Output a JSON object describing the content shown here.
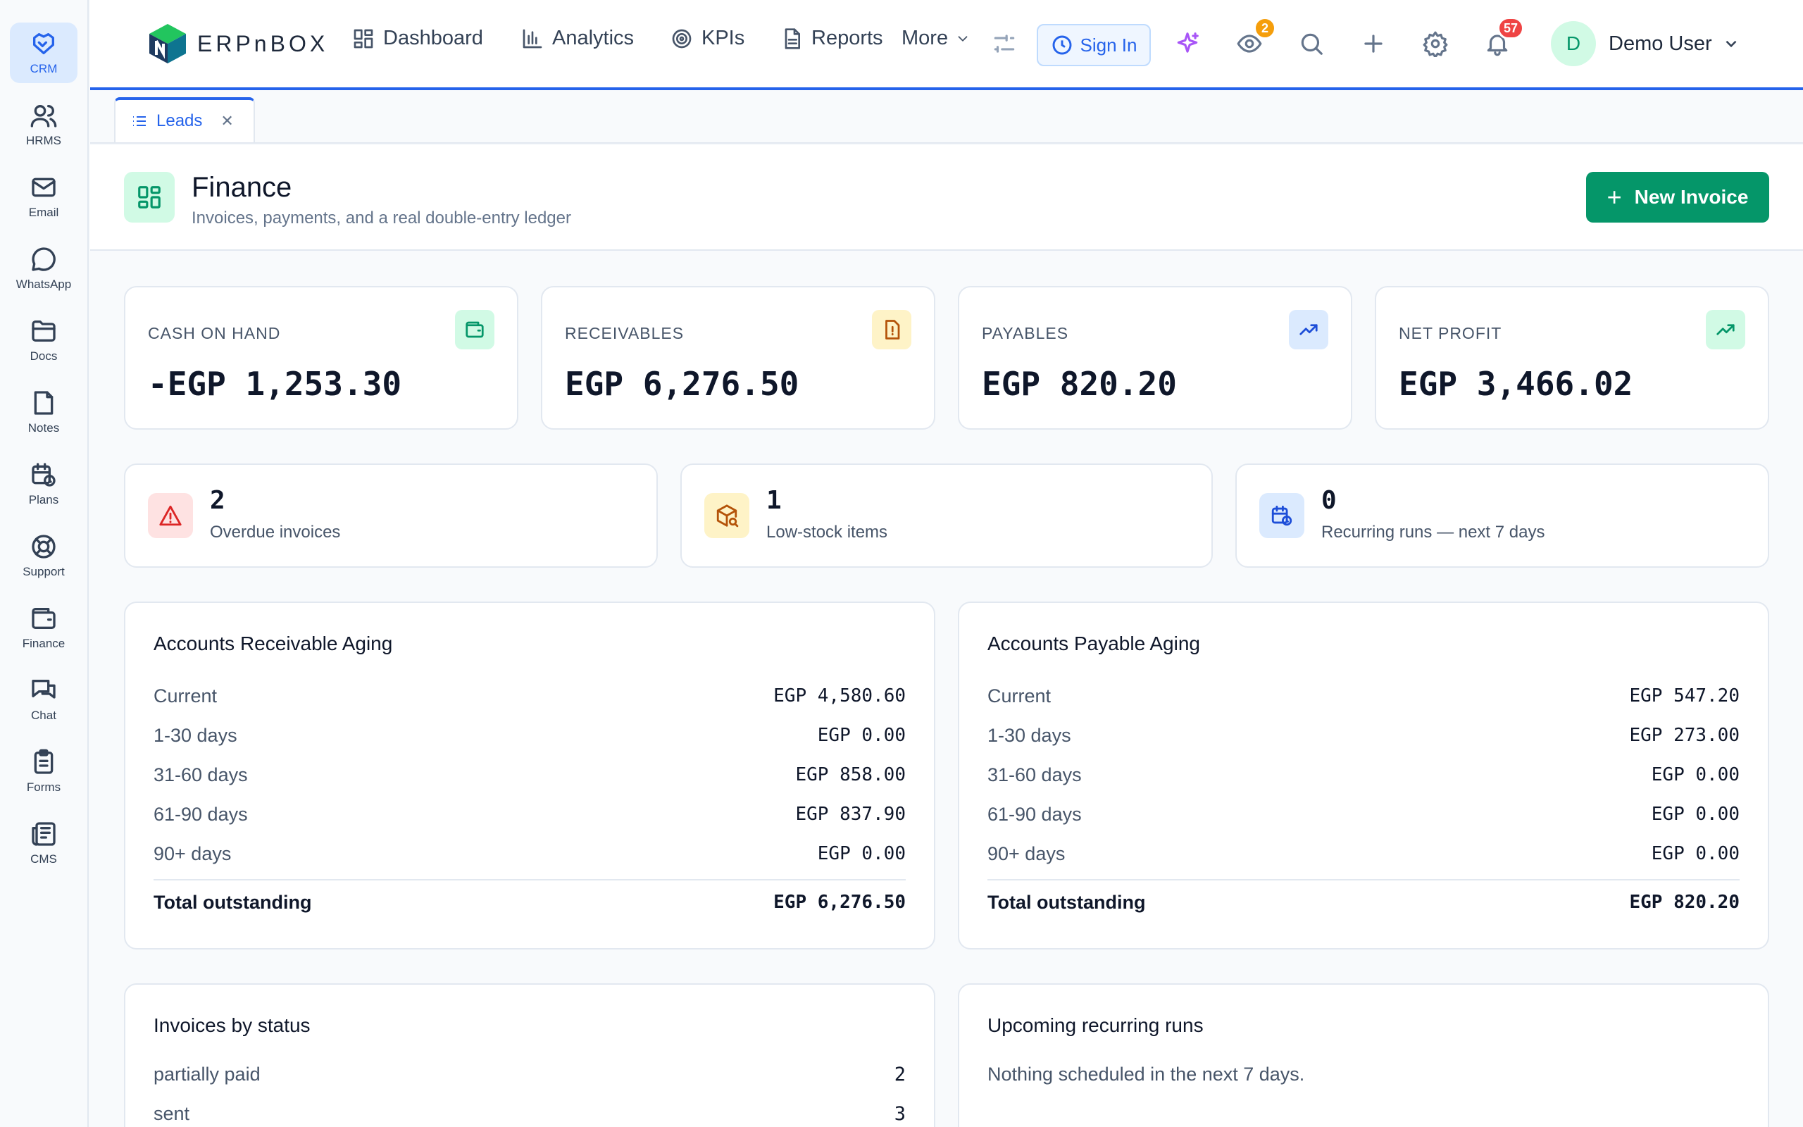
{
  "sidebar": {
    "items": [
      {
        "label": "CRM",
        "icon": "handshake-icon"
      },
      {
        "label": "HRMS",
        "icon": "users-icon"
      },
      {
        "label": "Email",
        "icon": "mail-icon"
      },
      {
        "label": "WhatsApp",
        "icon": "chat-bubble-icon"
      },
      {
        "label": "Docs",
        "icon": "folder-icon"
      },
      {
        "label": "Notes",
        "icon": "note-icon"
      },
      {
        "label": "Plans",
        "icon": "calendar-clock-icon"
      },
      {
        "label": "Support",
        "icon": "lifebuoy-icon"
      },
      {
        "label": "Finance",
        "icon": "wallet-icon"
      },
      {
        "label": "Chat",
        "icon": "messages-icon"
      },
      {
        "label": "Forms",
        "icon": "clipboard-icon"
      },
      {
        "label": "CMS",
        "icon": "newspaper-icon"
      }
    ]
  },
  "header": {
    "logo_text": "ERPnBOX",
    "nav": {
      "dashboard": "Dashboard",
      "analytics": "Analytics",
      "kpis": "KPIs",
      "reports": "Reports",
      "more": "More"
    },
    "signin_label": "Sign In",
    "watch_badge": "2",
    "notifications_badge": "57",
    "user": {
      "initial": "D",
      "name": "Demo User"
    }
  },
  "tabs": [
    {
      "label": "Leads"
    }
  ],
  "page": {
    "title": "Finance",
    "subtitle": "Invoices, payments, and a real double-entry ledger",
    "new_button": "New Invoice"
  },
  "kpis": [
    {
      "label": "CASH ON HAND",
      "value": "-EGP 1,253.30"
    },
    {
      "label": "RECEIVABLES",
      "value": "EGP 6,276.50"
    },
    {
      "label": "PAYABLES",
      "value": "EGP 820.20"
    },
    {
      "label": "NET PROFIT",
      "value": "EGP 3,466.02"
    }
  ],
  "stats": [
    {
      "value": "2",
      "label": "Overdue invoices"
    },
    {
      "value": "1",
      "label": "Low-stock items"
    },
    {
      "value": "0",
      "label": "Recurring runs — next 7 days"
    }
  ],
  "ar_aging": {
    "title": "Accounts Receivable Aging",
    "rows": [
      {
        "label": "Current",
        "value": "EGP 4,580.60"
      },
      {
        "label": "1-30 days",
        "value": "EGP 0.00"
      },
      {
        "label": "31-60 days",
        "value": "EGP 858.00"
      },
      {
        "label": "61-90 days",
        "value": "EGP 837.90"
      },
      {
        "label": "90+ days",
        "value": "EGP 0.00"
      }
    ],
    "total_label": "Total outstanding",
    "total_value": "EGP 6,276.50"
  },
  "ap_aging": {
    "title": "Accounts Payable Aging",
    "rows": [
      {
        "label": "Current",
        "value": "EGP 547.20"
      },
      {
        "label": "1-30 days",
        "value": "EGP 273.00"
      },
      {
        "label": "31-60 days",
        "value": "EGP 0.00"
      },
      {
        "label": "61-90 days",
        "value": "EGP 0.00"
      },
      {
        "label": "90+ days",
        "value": "EGP 0.00"
      }
    ],
    "total_label": "Total outstanding",
    "total_value": "EGP 820.20"
  },
  "invoices_by_status": {
    "title": "Invoices by status",
    "rows": [
      {
        "label": "partially paid",
        "value": "2"
      },
      {
        "label": "sent",
        "value": "3"
      }
    ]
  },
  "recurring": {
    "title": "Upcoming recurring runs",
    "empty": "Nothing scheduled in the next 7 days."
  },
  "colors": {
    "accent": "#2563eb",
    "brand": "#059669",
    "danger": "#ef4444",
    "warning": "#f59e0b"
  }
}
